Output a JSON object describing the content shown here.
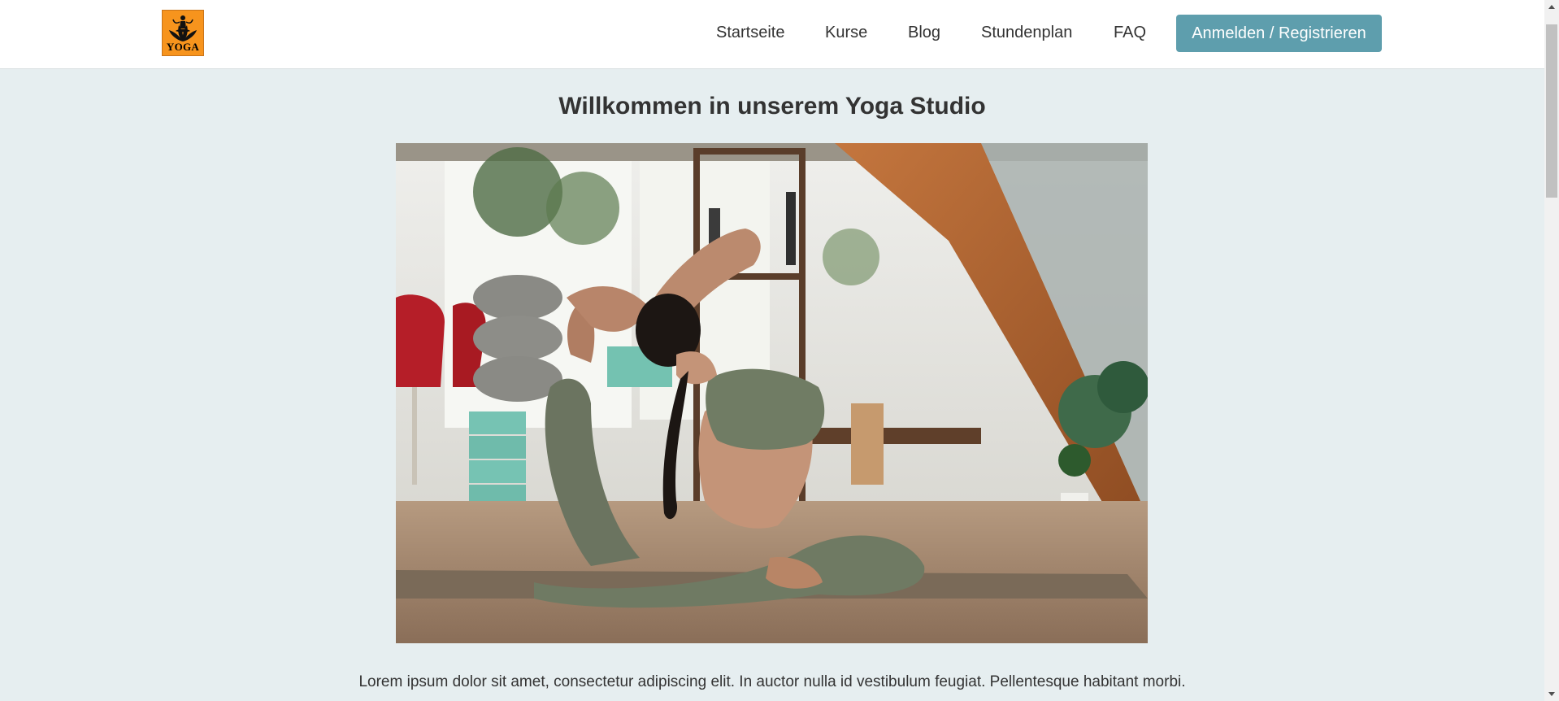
{
  "header": {
    "logo_text": "YOGA",
    "logo_color": "#f7941d",
    "nav": [
      {
        "label": "Startseite"
      },
      {
        "label": "Kurse"
      },
      {
        "label": "Blog"
      },
      {
        "label": "Stundenplan"
      },
      {
        "label": "FAQ"
      }
    ],
    "login_label": "Anmelden / Registrieren",
    "accent_color": "#5e9ead"
  },
  "main": {
    "title": "Willkommen in unserem Yoga Studio",
    "hero_icon": "yoga-pose-photo",
    "intro_text": "Lorem ipsum dolor sit amet, consectetur adipiscing elit. In auctor nulla id vestibulum feugiat. Pellentesque habitant morbi."
  },
  "colors": {
    "page_background": "#e6eef0",
    "text": "#333333"
  }
}
